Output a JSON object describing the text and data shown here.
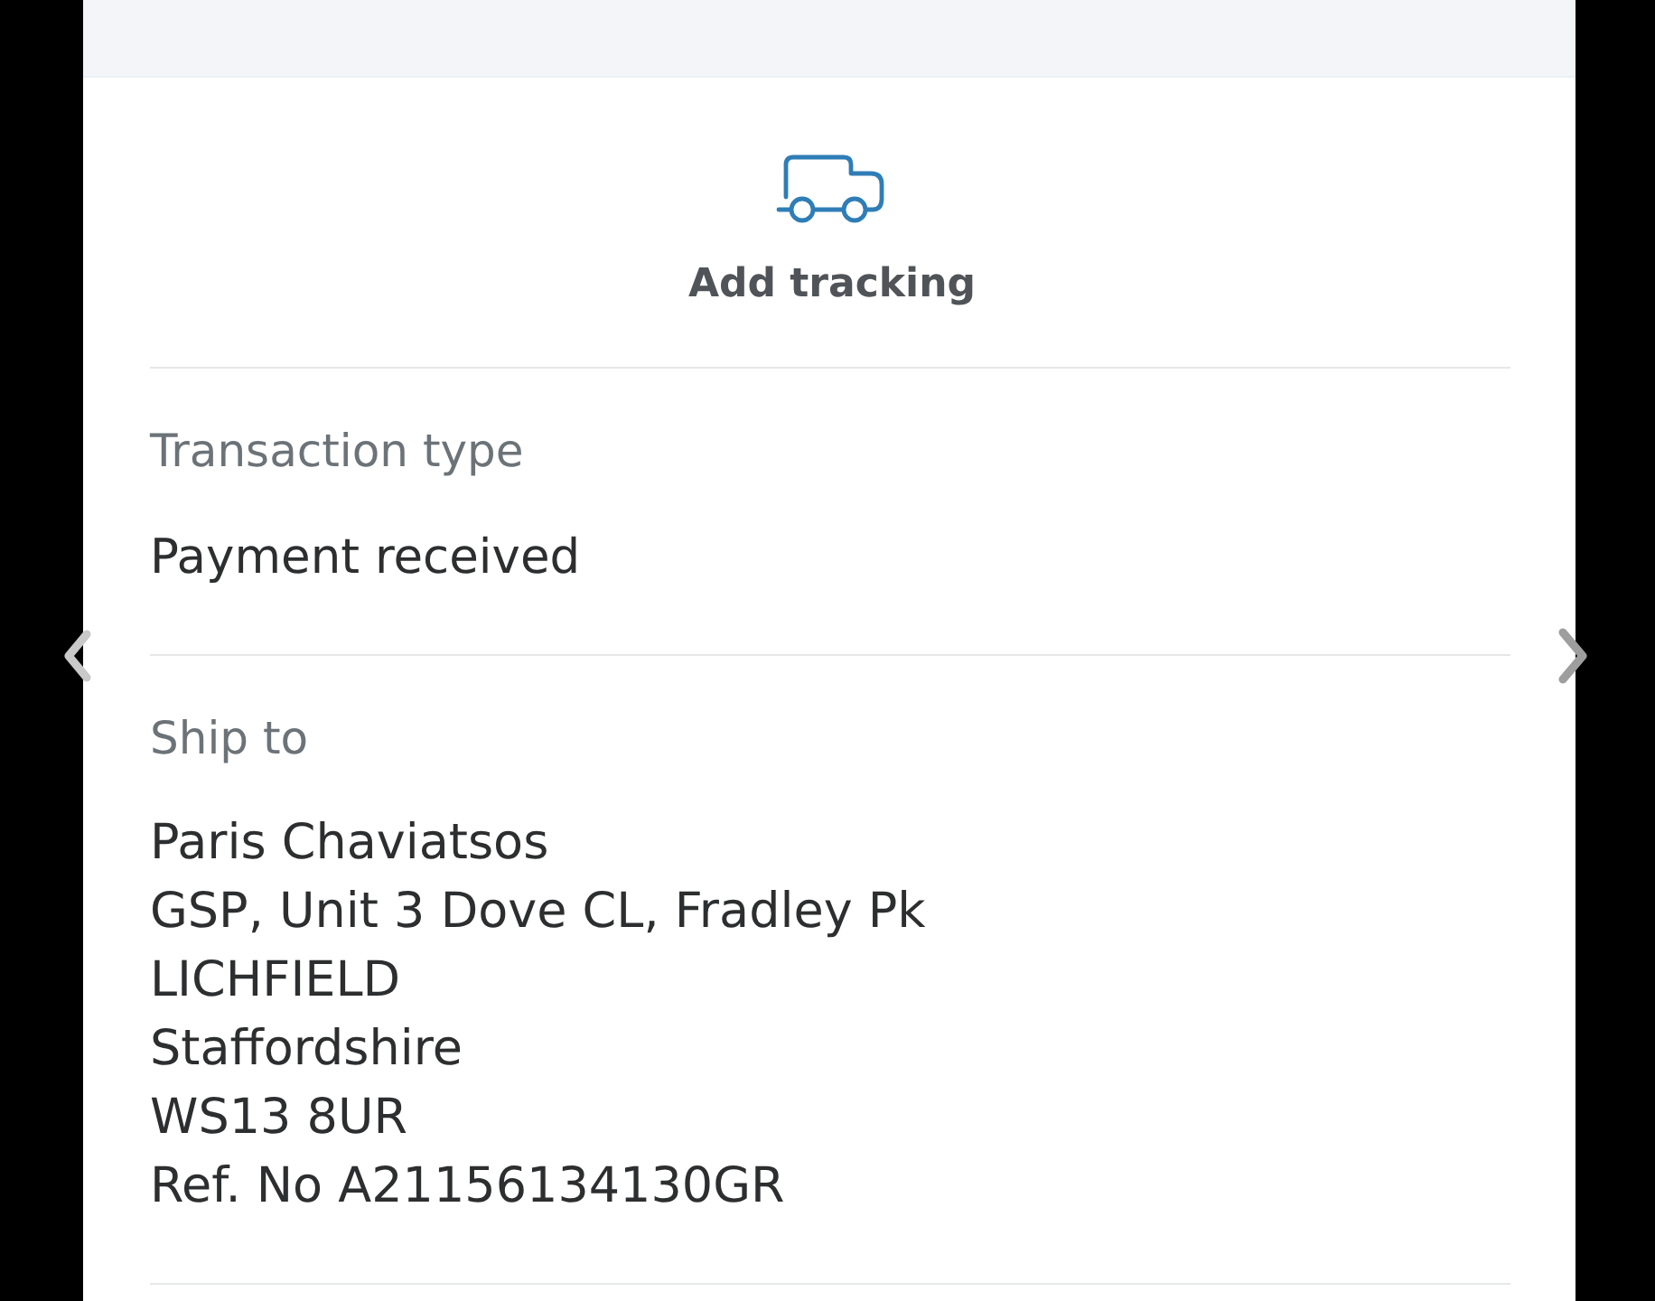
{
  "tracking_action": {
    "label": "Add tracking"
  },
  "details": [
    {
      "kind": "value",
      "label": "Transaction type",
      "lines": [
        "Payment received"
      ]
    },
    {
      "kind": "address",
      "label": "Ship to",
      "lines": [
        "Paris Chaviatsos",
        "GSP, Unit 3 Dove CL, Fradley Pk",
        "LICHFIELD",
        "Staffordshire",
        "WS13 8UR",
        "Ref. No A21156134130GR"
      ]
    }
  ]
}
